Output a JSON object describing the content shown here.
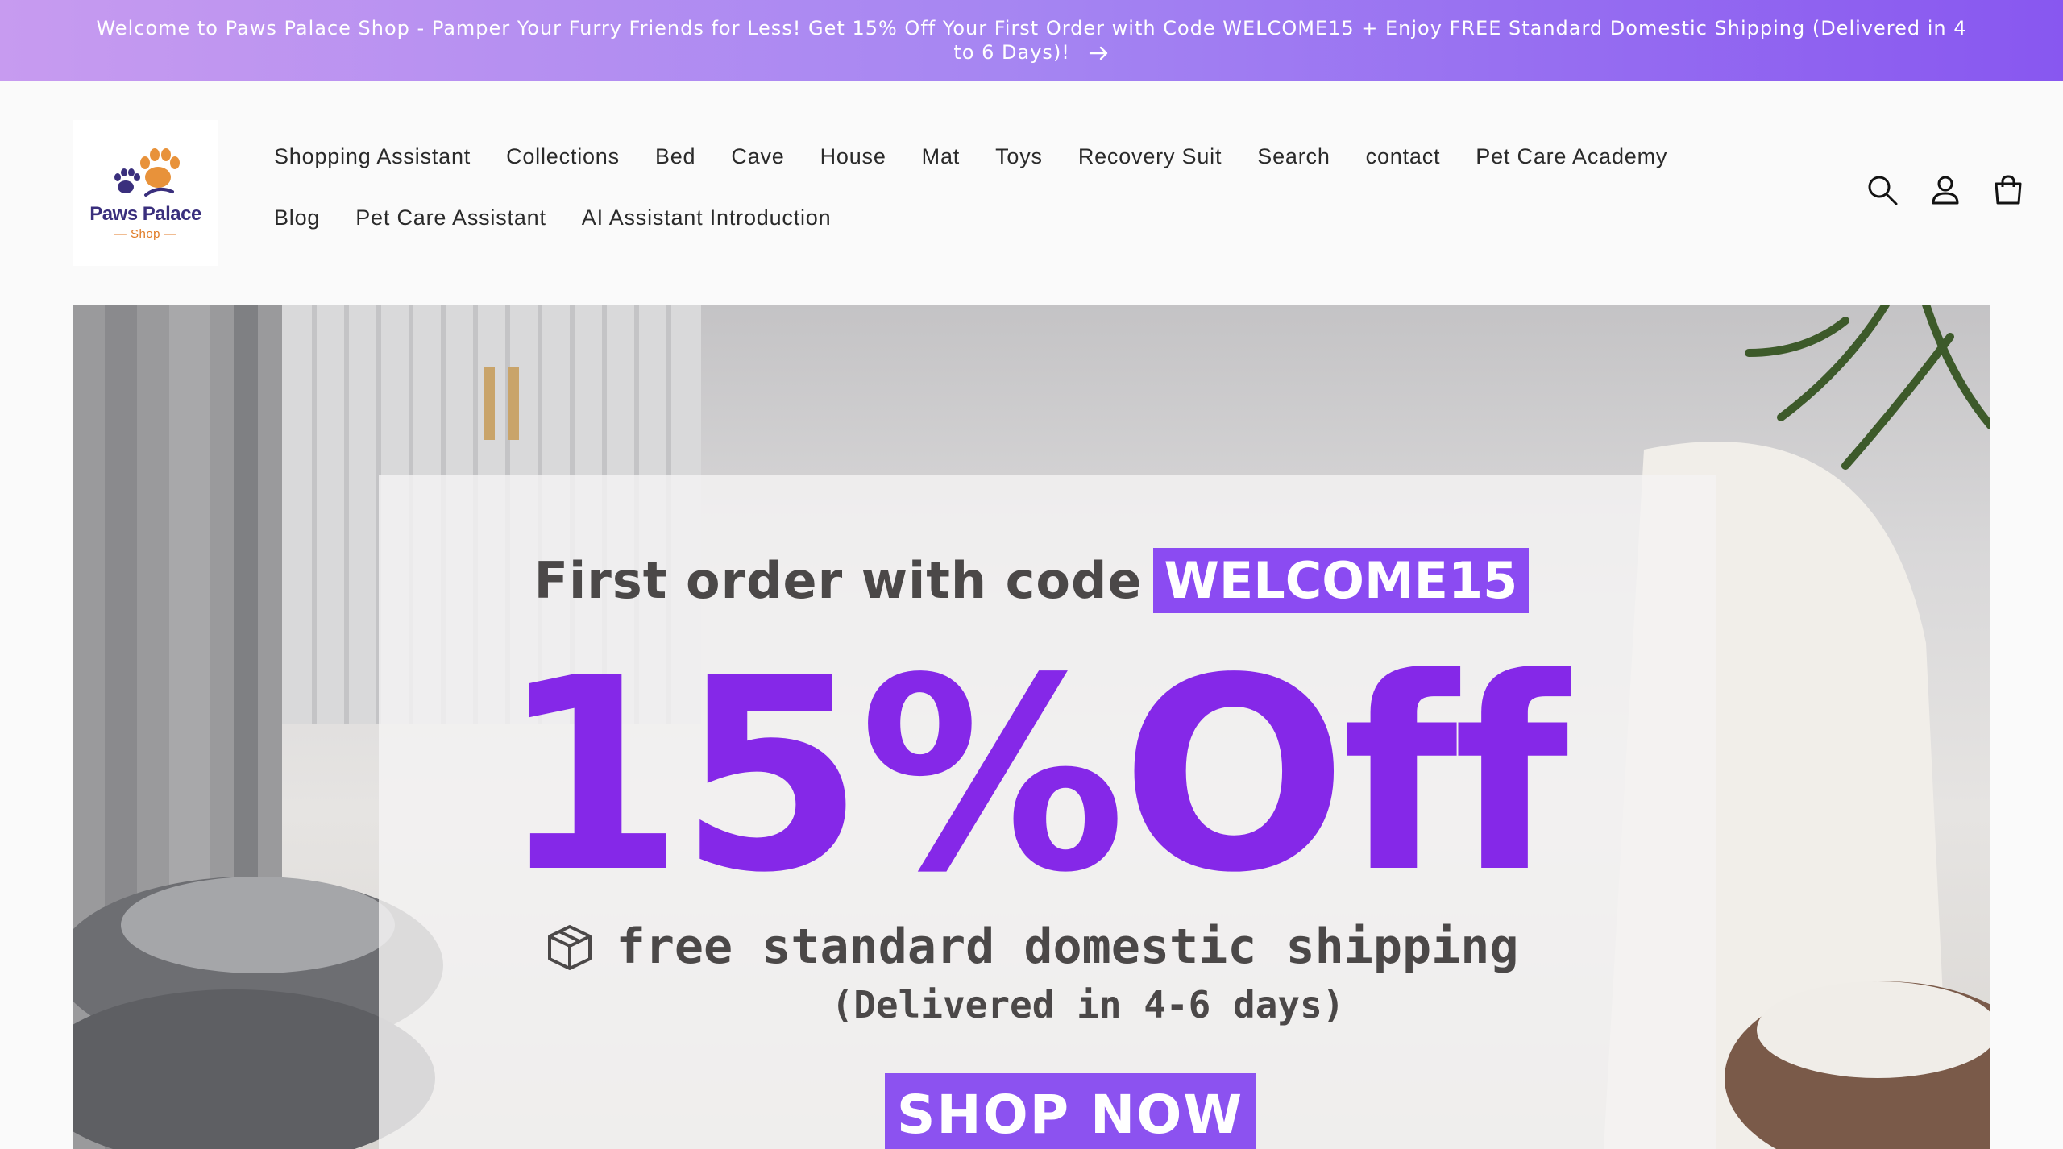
{
  "announcement": {
    "text": "Welcome to Paws Palace Shop - Pamper Your Furry Friends for Less! Get 15% Off Your First Order with Code WELCOME15 + Enjoy FREE Standard Domestic Shipping (Delivered in 4 to 6 Days)!",
    "icon": "arrow-right-icon"
  },
  "logo": {
    "name": "Paws Palace",
    "sub": "— Shop —"
  },
  "nav": {
    "items": [
      "Shopping Assistant",
      "Collections",
      "Bed",
      "Cave",
      "House",
      "Mat",
      "Toys",
      "Recovery Suit",
      "Search",
      "contact",
      "Pet Care Academy",
      "Blog",
      "Pet Care Assistant",
      "AI Assistant Introduction"
    ]
  },
  "header_icons": [
    "search-icon",
    "account-icon",
    "cart-icon"
  ],
  "hero": {
    "first_order": "First order with code",
    "code": "WELCOME15",
    "discount": "15%Off",
    "shipping": "free standard domestic shipping",
    "delivery": "(Delivered in 4-6 days)",
    "cta": "SHOP NOW"
  },
  "colors": {
    "accent": "#8528e8",
    "code_bg": "#8b4bf2",
    "announcement_start": "#c79bf0",
    "announcement_end": "#8857f0"
  }
}
